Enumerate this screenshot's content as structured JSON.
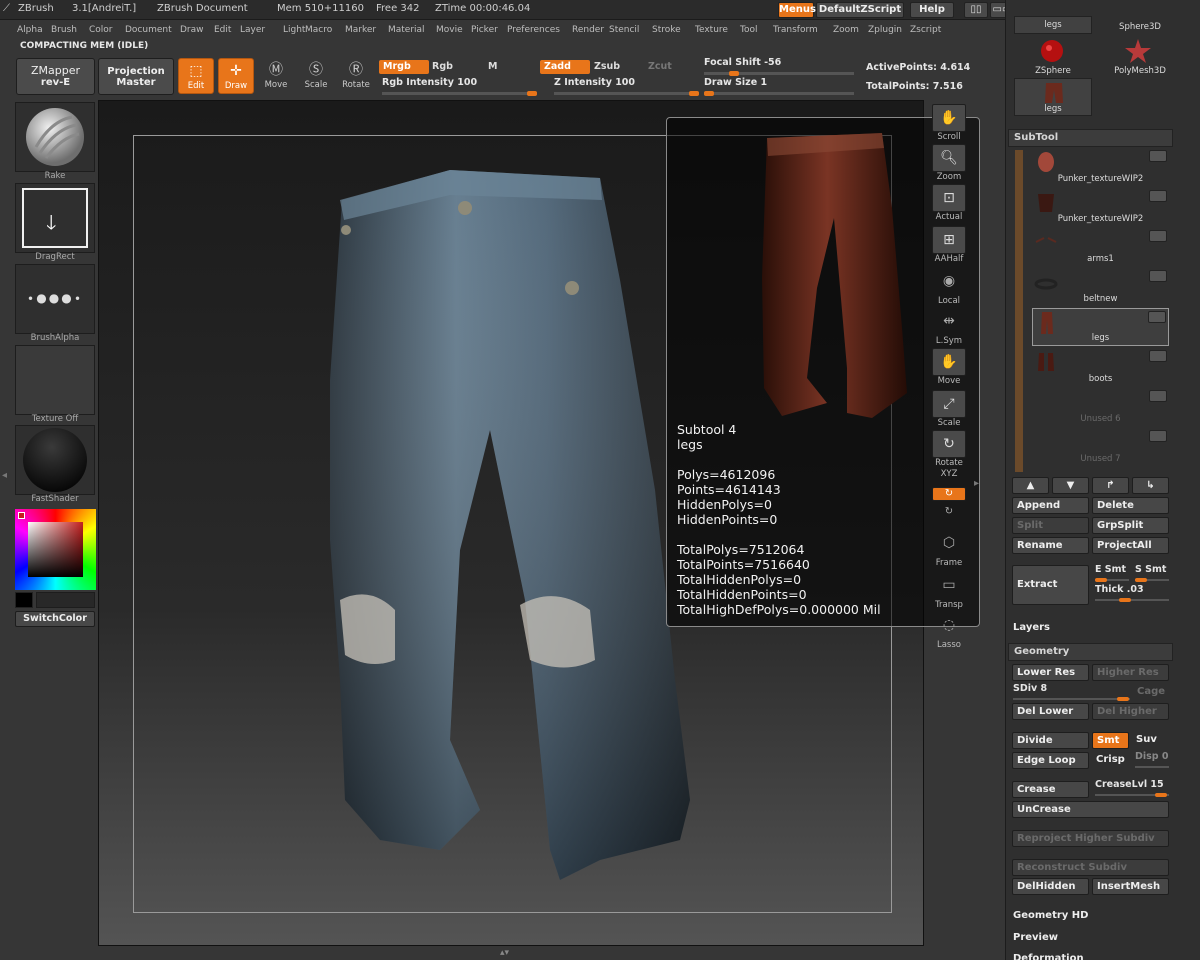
{
  "titlebar": {
    "app": "ZBrush",
    "version": "3.1[AndreiT.]",
    "document": "ZBrush Document",
    "mem": "Mem 510+11160",
    "free": "Free 342",
    "ztime": "ZTime 00:00:46.04",
    "menus_label": "Menus",
    "script_label": "DefaultZScript",
    "help_label": "Help"
  },
  "menubar": [
    "Alpha",
    "Brush",
    "Color",
    "Document",
    "Draw",
    "Edit",
    "Layer",
    "Light",
    "Macro",
    "Marker",
    "Material",
    "Movie",
    "Picker",
    "Preferences",
    "Render",
    "Stencil",
    "Stroke",
    "Texture",
    "Tool",
    "Transform",
    "Zoom",
    "Zplugin",
    "Zscript"
  ],
  "status": "COMPACTING MEM (IDLE)",
  "toolbar": {
    "zmapper": "ZMapper",
    "zmapper_sub": "rev-E",
    "projection": "Projection",
    "projection_sub": "Master",
    "edit": "Edit",
    "draw": "Draw",
    "move": "Move",
    "scale": "Scale",
    "rotate": "Rotate",
    "mrgb": "Mrgb",
    "rgb": "Rgb",
    "m": "M",
    "zadd": "Zadd",
    "zsub": "Zsub",
    "zcut": "Zcut",
    "rgb_intensity": "Rgb Intensity 100",
    "rgb_intensity_value": 100,
    "z_intensity": "Z Intensity 100",
    "z_intensity_value": 100,
    "focal_shift": "Focal Shift -56",
    "focal_shift_value": -56,
    "draw_size": "Draw Size 1",
    "draw_size_value": 1,
    "active_points": "ActivePoints: 4.614",
    "total_points": "TotalPoints: 7.516"
  },
  "shelf": {
    "rake": "Rake",
    "dragrect": "DragRect",
    "brushalpha": "BrushAlpha",
    "texture": "Texture  Off",
    "fastshader": "FastShader",
    "switchcolor": "SwitchColor"
  },
  "info": {
    "text": "Subtool 4\nlegs\n\nPolys=4612096\nPoints=4614143\nHiddenPolys=0\nHiddenPoints=0\n\nTotalPolys=7512064\nTotalPoints=7516640\nTotalHiddenPolys=0\nTotalHiddenPoints=0\nTotalHighDefPolys=0.000000 Mil"
  },
  "righttools": [
    "Scroll",
    "Zoom",
    "Actual",
    "AAHalf",
    "Local",
    "L.Sym",
    "Move",
    "Scale",
    "Rotate",
    "XYZ",
    "Frame",
    "Transp",
    "Lasso"
  ],
  "toolpalette": {
    "legs_top": "legs",
    "sphere3d": "Sphere3D",
    "zsphere": "ZSphere",
    "polymesh3d": "PolyMesh3D",
    "legs_thumb": "legs"
  },
  "subtool": {
    "header": "SubTool",
    "items": [
      "Punker_textureWIP2",
      "Punker_textureWIP2",
      "arms1",
      "beltnew",
      "legs",
      "boots",
      "Unused 6",
      "Unused 7"
    ],
    "append": "Append",
    "delete": "Delete",
    "split": "Split",
    "grpsplit": "GrpSplit",
    "rename": "Rename",
    "projectall": "ProjectAll",
    "extract": "Extract",
    "e_smt": "E Smt",
    "s_smt": "S Smt",
    "thick": "Thick .03"
  },
  "layers": "Layers",
  "geometry": {
    "header": "Geometry",
    "lower_res": "Lower Res",
    "higher_res": "Higher Res",
    "sdiv": "SDiv 8",
    "sdiv_value": 8,
    "cage": "Cage",
    "del_lower": "Del Lower",
    "del_higher": "Del Higher",
    "divide": "Divide",
    "smt": "Smt",
    "suv": "Suv",
    "edge_loop": "Edge Loop",
    "crisp": "Crisp",
    "disp": "Disp 0",
    "crease": "Crease",
    "creaselvl": "CreaseLvl 15",
    "uncrease": "UnCrease",
    "reproject": "Reproject Higher Subdiv",
    "reconstruct": "Reconstruct Subdiv",
    "delhidden": "DelHidden",
    "insertmesh": "InsertMesh"
  },
  "geometry_hd": "Geometry HD",
  "preview": "Preview",
  "deformation": "Deformation",
  "colors": {
    "accent": "#e8751a",
    "panel": "#2f2f2f",
    "jeans": "#4f6678",
    "leather": "#6b2a1d"
  }
}
